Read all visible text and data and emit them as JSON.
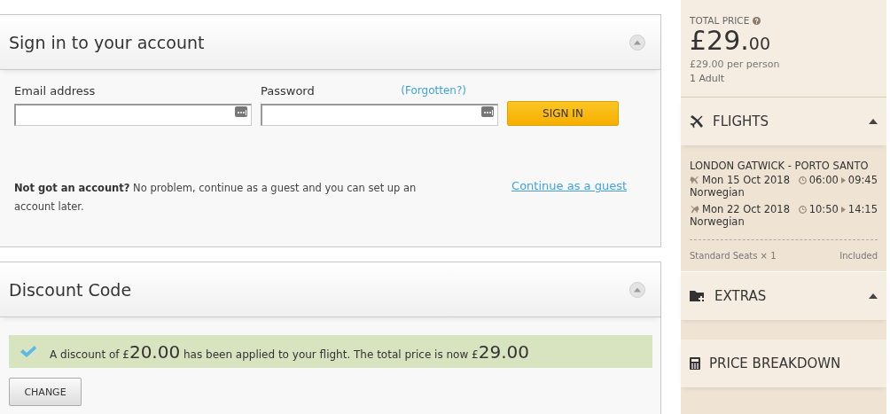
{
  "signin": {
    "title": "Sign in to your account",
    "email_label": "Email address",
    "password_label": "Password",
    "forgotten": "(Forgotten?)",
    "button": "SIGN IN",
    "note_bold": "Not got an account?",
    "note": "No problem, continue as a guest and you can set up an account later.",
    "guest_link": "Continue as a guest"
  },
  "discount": {
    "title": "Discount Code",
    "before": "A discount of £",
    "amount": "20.00",
    "middle": "has been applied to your flight. The total price is now £",
    "total": "29.00",
    "button": "CHANGE"
  },
  "summary": {
    "label": "TOTAL PRICE",
    "currency": "£",
    "whole": "29.",
    "cents": "00",
    "per_person": "£29.00 per person",
    "travellers": "1 Adult"
  },
  "sections": [
    {
      "kind": "flights",
      "title": "FLIGHTS",
      "expanded": true
    },
    {
      "kind": "extras",
      "title": "EXTRAS",
      "expanded": true
    },
    {
      "kind": "breakdown",
      "title": "PRICE BREAKDOWN"
    }
  ],
  "flights": {
    "route": "LONDON GATWICK - PORTO SANTO",
    "legs": [
      {
        "kind": "outbound",
        "date": "Mon 15 Oct 2018",
        "depart": "06:00",
        "arrive": "09:45",
        "airline": "Norwegian"
      },
      {
        "kind": "return",
        "date": "Mon 22 Oct 2018",
        "depart": "10:50",
        "arrive": "14:15",
        "airline": "Norwegian"
      }
    ],
    "seats": "Standard Seats × 1",
    "seats_price": "Included"
  }
}
